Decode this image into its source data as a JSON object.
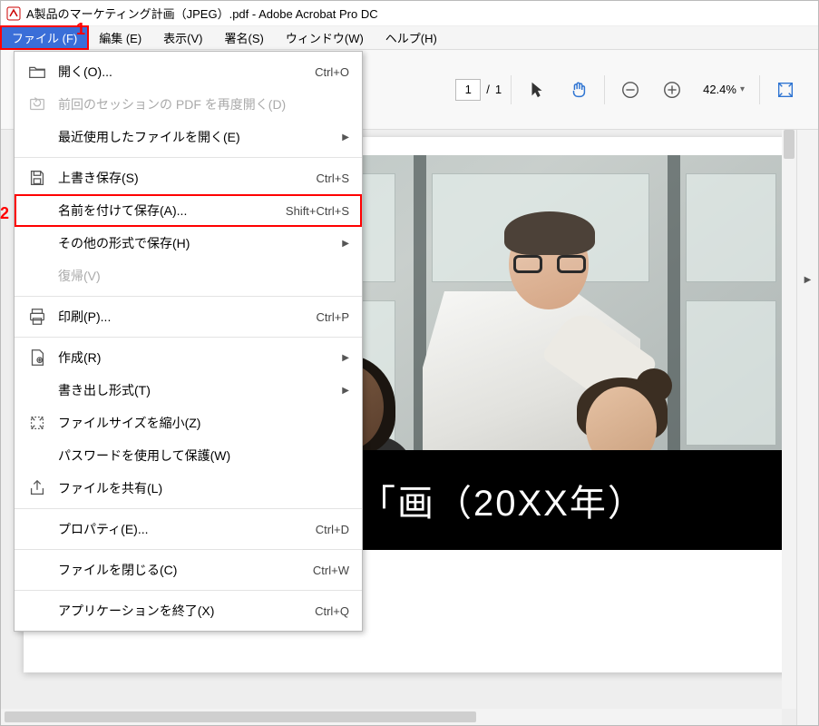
{
  "title": "A製品のマーケティング計画（JPEG）.pdf - Adobe Acrobat Pro DC",
  "callouts": {
    "one": "1",
    "two": "2"
  },
  "menubar": {
    "file": "ファイル (F)",
    "edit": "編集 (E)",
    "view": "表示(V)",
    "sign": "署名(S)",
    "window": "ウィンドウ(W)",
    "help": "ヘルプ(H)"
  },
  "fileMenu": {
    "open": {
      "label": "開く(O)...",
      "accel": "Ctrl+O"
    },
    "reopen": {
      "label": "前回のセッションの PDF を再度開く(D)",
      "accel": ""
    },
    "recent": {
      "label": "最近使用したファイルを開く(E)",
      "accel": ""
    },
    "save": {
      "label": "上書き保存(S)",
      "accel": "Ctrl+S"
    },
    "saveAs": {
      "label": "名前を付けて保存(A)...",
      "accel": "Shift+Ctrl+S"
    },
    "saveOther": {
      "label": "その他の形式で保存(H)",
      "accel": ""
    },
    "revert": {
      "label": "復帰(V)",
      "accel": ""
    },
    "print": {
      "label": "印刷(P)...",
      "accel": "Ctrl+P"
    },
    "create": {
      "label": "作成(R)",
      "accel": ""
    },
    "export": {
      "label": "書き出し形式(T)",
      "accel": ""
    },
    "reduce": {
      "label": "ファイルサイズを縮小(Z)",
      "accel": ""
    },
    "protect": {
      "label": "パスワードを使用して保護(W)",
      "accel": ""
    },
    "share": {
      "label": "ファイルを共有(L)",
      "accel": ""
    },
    "properties": {
      "label": "プロパティ(E)...",
      "accel": "Ctrl+D"
    },
    "close": {
      "label": "ファイルを閉じる(C)",
      "accel": "Ctrl+W"
    },
    "exit": {
      "label": "アプリケーションを終了(X)",
      "accel": "Ctrl+Q"
    }
  },
  "toolbar": {
    "page_current": "1",
    "page_sep": "/",
    "page_total": "1",
    "zoom_pct": "42.4%"
  },
  "document": {
    "title_visible": "「画（20XX年）"
  }
}
